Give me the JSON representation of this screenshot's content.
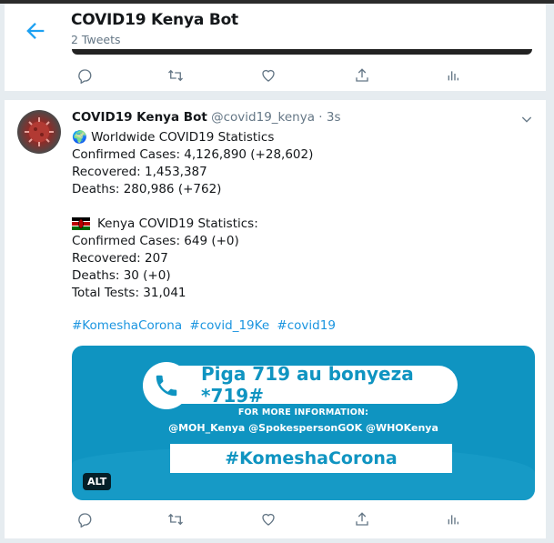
{
  "header": {
    "title": "COVID19 Kenya Bot",
    "subtitle": "2 Tweets"
  },
  "tweet": {
    "name": "COVID19 Kenya Bot",
    "handle": "@covid19_kenya",
    "separator": "·",
    "time": "3s",
    "lines": [
      "🌍 Worldwide COVID19 Statistics",
      "Confirmed Cases: 4,126,890 (+28,602)",
      "Recovered: 1,453,387",
      "Deaths: 280,986 (+762)",
      "Kenya COVID19 Statistics:",
      "Confirmed Cases: 649 (+0)",
      "Recovered: 207",
      "Deaths: 30 (+0)",
      "Total Tests: 31,041"
    ],
    "hashtags": [
      "#KomeshaCorona",
      "#covid_19Ke",
      "#covid19"
    ],
    "media": {
      "piga": "Piga 719 au bonyeza *719#",
      "more_info": "FOR MORE INFORMATION:",
      "handles": "@MOH_Kenya @SpokespersonGOK @WHOKenya",
      "komesha": "#KomeshaCorona",
      "alt_label": "ALT"
    }
  },
  "icons": {
    "back": "arrow-left-icon",
    "reply": "reply-icon",
    "retweet": "retweet-icon",
    "like": "like-icon",
    "share": "share-icon",
    "analytics": "analytics-icon",
    "caret": "chevron-down-icon",
    "flag": "kenya-flag-icon"
  },
  "colors": {
    "accent": "#1da1f2",
    "hashtag": "#1b95e0",
    "muted": "#657786",
    "media_bg": "#0f94c1"
  }
}
